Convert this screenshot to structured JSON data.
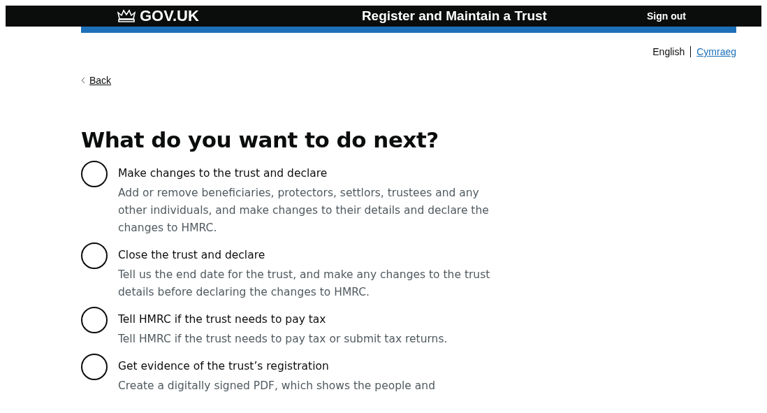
{
  "header": {
    "logo": "GOV.UK",
    "service_name": "Register and Maintain a Trust",
    "sign_out": "Sign out"
  },
  "language": {
    "current": "English",
    "other": "Cymraeg"
  },
  "back_link": "Back",
  "question": "What do you want to do next?",
  "options": [
    {
      "label": "Make changes to the trust and declare",
      "hint": "Add or remove beneficiaries, protectors, settlors, trustees and any other individuals, and make changes to their details and declare the changes to HMRC.",
      "selected": false
    },
    {
      "label": "Close the trust and declare",
      "hint": "Tell us the end date for the trust, and make any changes to the trust details before declaring the changes to HMRC.",
      "selected": false
    },
    {
      "label": "Tell HMRC if the trust needs to pay tax",
      "hint": "Tell HMRC if the trust needs to pay tax or submit tax returns.",
      "selected": false
    },
    {
      "label": "Get evidence of the trust’s registration",
      "hint": "Create a digitally signed PDF, which shows the people and",
      "selected": false
    }
  ]
}
